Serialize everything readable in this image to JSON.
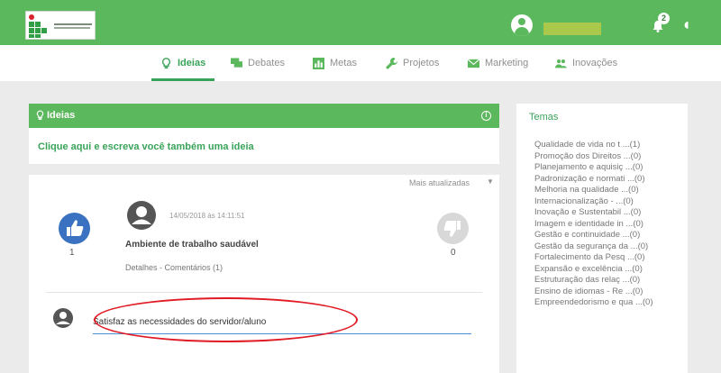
{
  "header": {
    "logo_alt": "logo",
    "notification_count": "2"
  },
  "nav": {
    "tabs": [
      {
        "label": "Ideias",
        "icon": "lightbulb-icon",
        "active": true
      },
      {
        "label": "Debates",
        "icon": "chat-icon",
        "active": false
      },
      {
        "label": "Metas",
        "icon": "bar-chart-icon",
        "active": false
      },
      {
        "label": "Projetos",
        "icon": "wrench-icon",
        "active": false
      },
      {
        "label": "Marketing",
        "icon": "envelope-icon",
        "active": false
      },
      {
        "label": "Inovações",
        "icon": "people-icon",
        "active": false
      }
    ]
  },
  "ideas_panel": {
    "title": "Ideias",
    "write_prompt": "Clique aqui e escreva você também uma ideia",
    "sort_label": "Mais atualizadas",
    "sort_arrow": "▼"
  },
  "idea": {
    "date": "14/05/2018 às 14:11:51",
    "title": "Ambiente de trabalho saudável",
    "links": "Detalhes - Comentários (1)",
    "likes": "1",
    "dislikes": "0"
  },
  "comment": {
    "value": "Satisfaz as necessidades do servidor/aluno"
  },
  "sidebar": {
    "title": "Temas",
    "themes": [
      "Qualidade de vida no t ...(1)",
      "Promoção dos Direitos ...(0)",
      "Planejamento e aquisiç ...(0)",
      "Padronização e normati ...(0)",
      "Melhoria na qualidade ...(0)",
      "Internacionalização - ...(0)",
      "Inovação e Sustentabil ...(0)",
      "Imagem e identidade in ...(0)",
      "Gestão e continuidade ...(0)",
      "Gestão da segurança da ...(0)",
      "Fortalecimento da Pesq ...(0)",
      "Expansão e excelência ...(0)",
      "Estruturação das relaç ...(0)",
      "Ensino de idiomas - Re ...(0)",
      "Empreendedorismo e qua ...(0)"
    ]
  },
  "colors": {
    "brand_green": "#5cb85c",
    "active_green": "#3aa35a",
    "like_blue": "#3a71c1",
    "highlight_red": "#e01b24"
  }
}
